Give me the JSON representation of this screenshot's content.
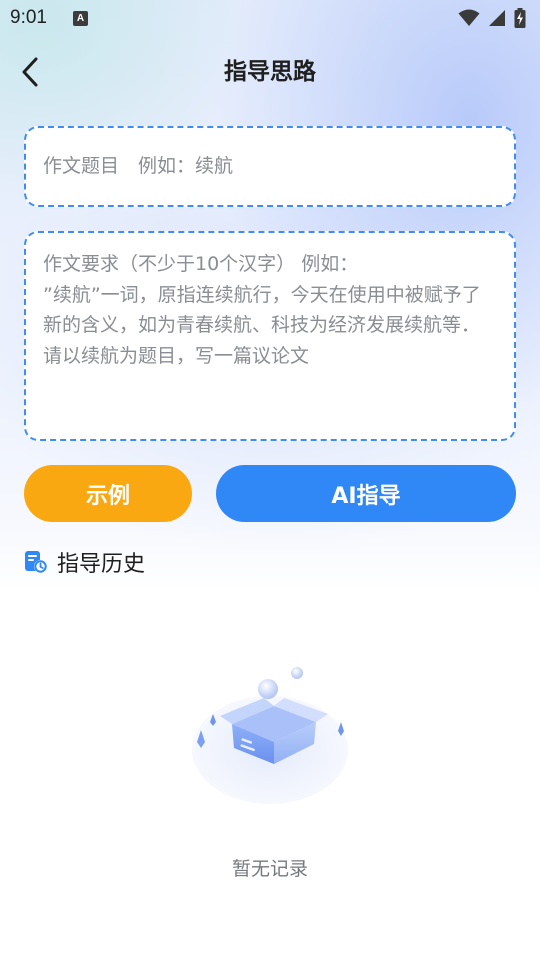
{
  "status_bar": {
    "time": "9:01",
    "notification_icon_letter": "A",
    "icons": [
      "wifi-icon",
      "signal-icon",
      "battery-charging-icon"
    ]
  },
  "header": {
    "back_icon": "chevron-left-icon",
    "title": "指导思路"
  },
  "form": {
    "title_field": {
      "placeholder": "作文题目　例如：续航",
      "value": ""
    },
    "requirement_field": {
      "placeholder": "作文要求（不少于10个汉字） 例如：\n”续航”一词，原指连续航行，今天在使用中被赋予了新的含义，如为青春续航、科技为经济发展续航等．请以续航为题目，写一篇议论文",
      "value": ""
    }
  },
  "actions": {
    "example_label": "示例",
    "ai_guide_label": "AI指导"
  },
  "history": {
    "icon": "history-clock-icon",
    "title": "指导历史",
    "empty_text": "暂无记录",
    "empty_illustration": "empty-box-illustration"
  },
  "colors": {
    "accent_blue": "#2f88f5",
    "dashed_border": "#3f8cf2",
    "example_orange": "#faa811"
  }
}
